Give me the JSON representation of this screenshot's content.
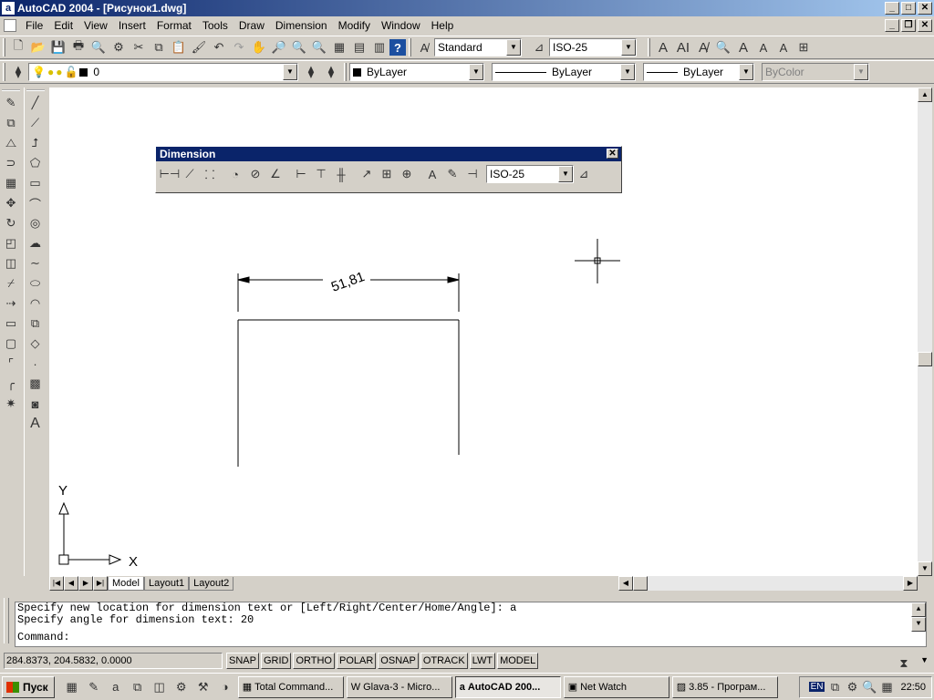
{
  "window": {
    "title": "AutoCAD 2004 - [Рисунок1.dwg]",
    "app_icon": "a"
  },
  "menu": [
    "File",
    "Edit",
    "View",
    "Insert",
    "Format",
    "Tools",
    "Draw",
    "Dimension",
    "Modify",
    "Window",
    "Help"
  ],
  "standard_toolbar": {
    "text_style": "Standard",
    "dim_style": "ISO-25"
  },
  "layers_toolbar": {
    "layer": "0",
    "color": "ByLayer",
    "linetype": "ByLayer",
    "lineweight": "ByLayer",
    "plot_style": "ByColor"
  },
  "dimension_toolbar": {
    "title": "Dimension",
    "dim_style": "ISO-25"
  },
  "drawing": {
    "dimension_text": "51,81",
    "ucs_x": "X",
    "ucs_y": "Y"
  },
  "layout_tabs": [
    "Model",
    "Layout1",
    "Layout2"
  ],
  "command": {
    "history": [
      "Specify new location for dimension text or [Left/Right/Center/Home/Angle]: a",
      "Specify angle for dimension text: 20"
    ],
    "prompt": "Command:"
  },
  "status": {
    "coordinates": "284.8373, 204.5832, 0.0000",
    "toggles": [
      "SNAP",
      "GRID",
      "ORTHO",
      "POLAR",
      "OSNAP",
      "OTRACK",
      "LWT",
      "MODEL"
    ]
  },
  "taskbar": {
    "start": "Пуск",
    "tasks": [
      "Total Command...",
      "Glava-3 - Micro...",
      "AutoCAD 200...",
      "Net Watch",
      "3.85 - Програм..."
    ],
    "active_task": 2,
    "lang": "EN",
    "clock": "22:50"
  },
  "colors": {
    "title_start": "#0a246a",
    "title_end": "#a6caf0",
    "face": "#d4d0c8"
  }
}
